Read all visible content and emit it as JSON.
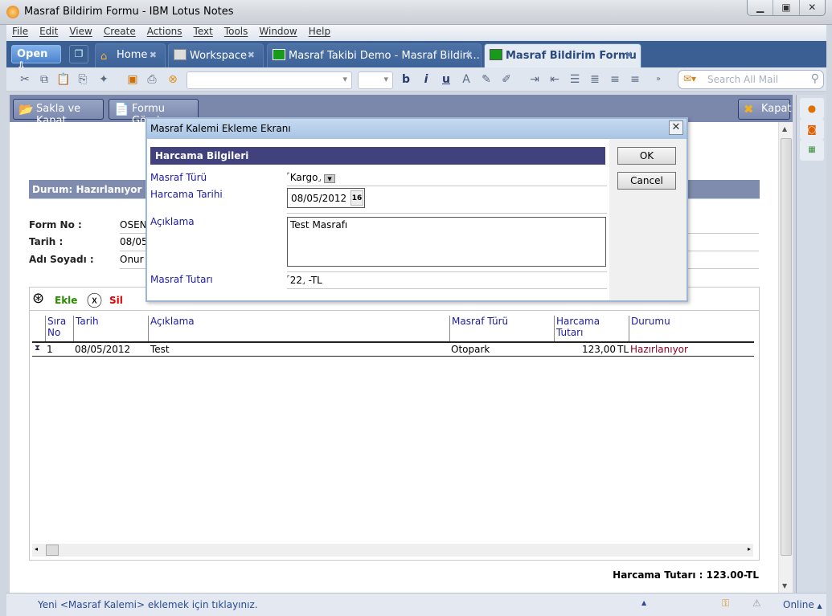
{
  "window": {
    "title": "Masraf Bildirim Formu - IBM Lotus Notes",
    "controls": [
      "minimize",
      "maximize",
      "close"
    ]
  },
  "menu": [
    "File",
    "Edit",
    "View",
    "Create",
    "Actions",
    "Text",
    "Tools",
    "Window",
    "Help"
  ],
  "tabs": {
    "open_label": "Open",
    "items": [
      {
        "label": "Home",
        "icon": "home-icon"
      },
      {
        "label": "Workspace",
        "icon": "workspace-icon"
      },
      {
        "label": "Masraf Takibi Demo - Masraf Bildiri...",
        "icon": "database-icon"
      },
      {
        "label": "Masraf Bildirim Formu",
        "icon": "form-icon",
        "active": true
      }
    ]
  },
  "toolbar": {
    "search_placeholder": "Search All Mail"
  },
  "actions": {
    "save_close": "Sakla ve Kapat",
    "send_form": "Formu Gönder",
    "close": "Kapat"
  },
  "form": {
    "status": "Durum: Hazırlanıyor",
    "fields": [
      {
        "label": "Form No :",
        "value": "OSEN"
      },
      {
        "label": "Tarih :",
        "value": "08/05"
      },
      {
        "label": "Adı Soyadı :",
        "value": "Onur"
      }
    ],
    "add_label": "Ekle",
    "delete_label": "Sil",
    "columns": [
      "Sıra No",
      "Tarih",
      "Açıklama",
      "Masraf Türü",
      "Harcama Tutarı",
      "Durumu"
    ],
    "rows": [
      {
        "no": "1",
        "date": "08/05/2012",
        "desc": "Test",
        "type": "Otopark",
        "amount": "123,00",
        "currency": "TL",
        "status": "Hazırlanıyor"
      }
    ],
    "total": "Harcama Tutarı : 123.00-TL"
  },
  "dialog": {
    "title": "Masraf Kalemi Ekleme Ekranı",
    "section": "Harcama Bilgileri",
    "fields": {
      "type_label": "Masraf Türü",
      "type_value": "Kargo",
      "date_label": "Harcama Tarihi",
      "date_value": "08/05/2012",
      "calendar_day": "16",
      "desc_label": "Açıklama",
      "desc_value": "Test Masrafı",
      "amount_label": "Masraf Tutarı",
      "amount_value": "22",
      "amount_suffix": "-TL"
    },
    "ok": "OK",
    "cancel": "Cancel"
  },
  "status": {
    "message": "Yeni <Masraf Kalemi> eklemek için tıklayınız.",
    "online": "Online"
  },
  "colors": {
    "tabbar": "#3b5f93",
    "actionbar": "#7b88ab",
    "section": "#41417e",
    "label": "#1c1ca0",
    "ekle": "#2a8a00",
    "sil": "#e00000",
    "status_text": "#8b0020"
  }
}
